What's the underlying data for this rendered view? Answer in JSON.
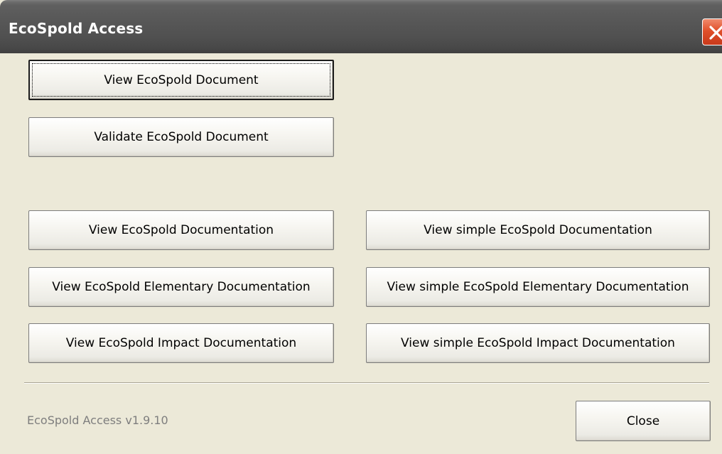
{
  "window": {
    "title": "EcoSpold Access"
  },
  "buttons": {
    "view_document": "View EcoSpold Document",
    "validate_document": "Validate EcoSpold Document",
    "view_documentation": "View EcoSpold Documentation",
    "view_simple_documentation": "View simple EcoSpold Documentation",
    "view_elementary_documentation": "View EcoSpold Elementary Documentation",
    "view_simple_elementary_documentation": "View simple EcoSpold Elementary Documentation",
    "view_impact_documentation": "View EcoSpold Impact Documentation",
    "view_simple_impact_documentation": "View simple EcoSpold Impact Documentation",
    "close": "Close"
  },
  "footer": {
    "version": "EcoSpold Access v1.9.10"
  },
  "icons": {
    "title_close": "close-icon"
  },
  "colors": {
    "title_bar": "#575757",
    "close_button": "#e0502a",
    "dialog_background": "#ece9d8",
    "version_text": "#7e7e7e"
  }
}
